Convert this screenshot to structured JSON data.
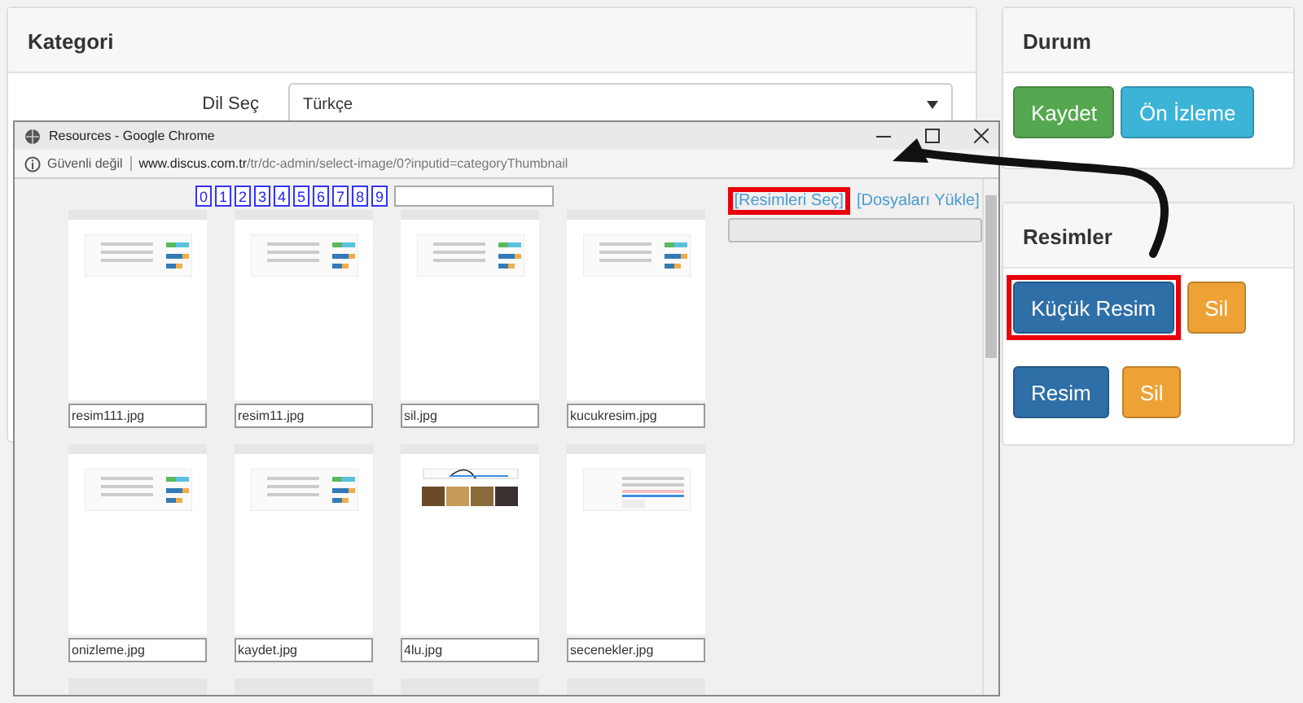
{
  "category_panel": {
    "title": "Kategori",
    "field": {
      "label": "Dil Seç",
      "value": "Türkçe"
    }
  },
  "popup": {
    "title": "Resources - Google Chrome",
    "security": "Güvenli değil",
    "host": "www.discus.com.tr",
    "path": "/tr/dc-admin/select-image/0?inputid=categoryThumbnail",
    "pager": [
      "0",
      "1",
      "2",
      "3",
      "4",
      "5",
      "6",
      "7",
      "8",
      "9"
    ],
    "links": [
      {
        "label": "[Resimleri Seç]",
        "highlighted": true
      },
      {
        "label": "[Dosyaları Yükle]",
        "highlighted": false
      }
    ],
    "files": [
      {
        "name": "resim111.jpg",
        "kind": "form"
      },
      {
        "name": "resim11.jpg",
        "kind": "form"
      },
      {
        "name": "sil.jpg",
        "kind": "form"
      },
      {
        "name": "kucukresim.jpg",
        "kind": "form"
      },
      {
        "name": "onizleme.jpg",
        "kind": "form"
      },
      {
        "name": "kaydet.jpg",
        "kind": "form"
      },
      {
        "name": "4lu.jpg",
        "kind": "photos"
      },
      {
        "name": "secenekler.jpg",
        "kind": "list"
      }
    ]
  },
  "status_panel": {
    "title": "Durum",
    "buttons": [
      {
        "label": "Kaydet",
        "kind": "success"
      },
      {
        "label": "Ön İzleme",
        "kind": "info"
      }
    ]
  },
  "images_panel": {
    "title": "Resimler",
    "rows": [
      {
        "image_button": "Küçük Resim",
        "delete_button": "Sil",
        "highlighted": true
      },
      {
        "image_button": "Resim",
        "delete_button": "Sil",
        "highlighted": false
      }
    ]
  }
}
